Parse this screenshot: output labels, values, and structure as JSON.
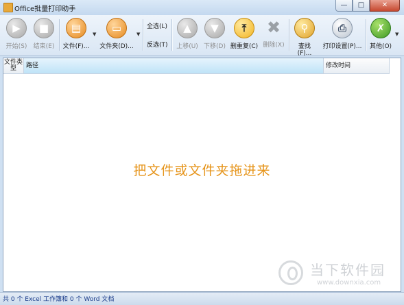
{
  "window": {
    "title": "Office批量打印助手",
    "buttons": {
      "minimize": "—",
      "maximize": "□",
      "close": "✕"
    }
  },
  "toolbar": {
    "start": "开始(S)",
    "stop": "结束(E)",
    "file": "文件(F)...",
    "folder": "文件夹(D)...",
    "select_all": "全选(L)",
    "invert": "反选(T)",
    "move_up": "上移(U)",
    "move_down": "下移(D)",
    "remove_dup": "删重复(C)",
    "delete": "删除(X)",
    "find": "查找(F)...",
    "print_settings": "打印设置(P)...",
    "other": "其他(O)"
  },
  "list": {
    "columns": {
      "type": "文件类型",
      "path": "路径",
      "modified": "修改时间"
    },
    "placeholder": "把文件或文件夹拖进来"
  },
  "watermark": {
    "title": "当下软件园",
    "url": "www.downxia.com"
  },
  "status": {
    "text": "共 0 个 Excel 工作簿和 0 个 Word 文档"
  },
  "colors": {
    "accent": "#e6941a",
    "status_text": "#1a3b8a",
    "header_selected": "#bfe3f7"
  }
}
